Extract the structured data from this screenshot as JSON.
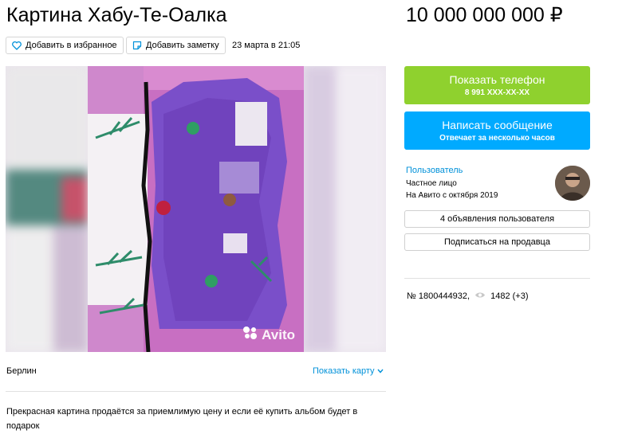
{
  "listing": {
    "title": "Картина Хабу-Те-Оалка",
    "price": "10 000 000 000 ₽",
    "add_favorite_label": "Добавить в избранное",
    "add_note_label": "Добавить заметку",
    "date": "23 марта в 21:05",
    "watermark": "Avito",
    "city": "Берлин",
    "show_map_label": "Показать карту",
    "description": "Прекрасная картина продаётся за приемлимую цену и если её купить альбом будет в подарок"
  },
  "contact": {
    "phone_button_label": "Показать телефон",
    "phone_masked": "8 991 XXX-XX-XX",
    "message_button_label": "Написать сообщение",
    "message_subtitle": "Отвечает за несколько часов"
  },
  "seller": {
    "name": "Пользователь",
    "type": "Частное лицо",
    "since": "На Авито с октября 2019",
    "listings_button_label": "4 объявления пользователя",
    "subscribe_button_label": "Подписаться на продавца"
  },
  "ad_info": {
    "number": "№ 1800444932,",
    "views": "1482 (+3)"
  },
  "colors": {
    "green_button": "#8fd12e",
    "blue_button": "#00aaff",
    "link": "#0091d9"
  },
  "icons": [
    "heart-icon",
    "note-icon",
    "chevron-down-icon",
    "eye-icon",
    "avito-logo-icon"
  ]
}
